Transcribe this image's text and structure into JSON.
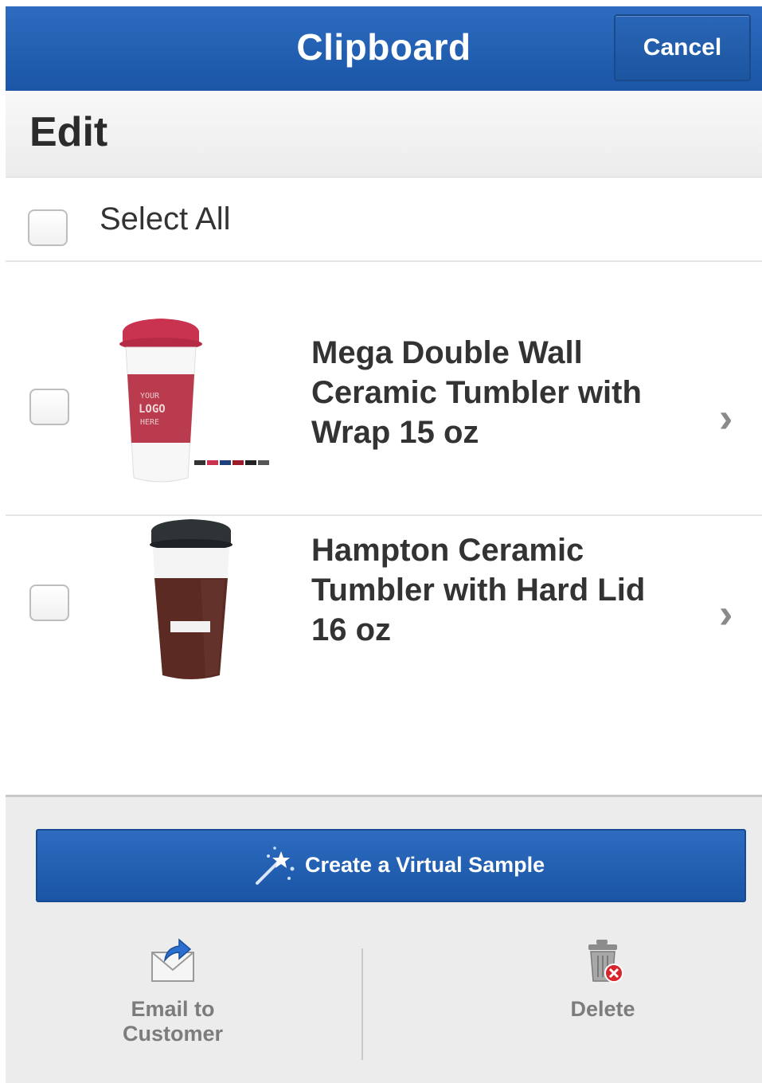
{
  "header": {
    "title": "Clipboard",
    "cancel_label": "Cancel"
  },
  "edit": {
    "title": "Edit"
  },
  "select_all": {
    "label": "Select All",
    "checked": false
  },
  "items": [
    {
      "title": "Mega Double Wall Ceramic Tumbler with Wrap 15 oz",
      "checked": false,
      "thumb_icon": "red-ceramic-tumbler-image",
      "thumb_text": "YOUR LOGO HERE"
    },
    {
      "title": "Hampton Ceramic Tumbler with Hard Lid 16 oz",
      "checked": false,
      "thumb_icon": "brown-ceramic-tumbler-image"
    }
  ],
  "actions": {
    "virtual_sample_label": "Create a Virtual Sample",
    "email_label_line1": "Email to",
    "email_label_line2": "Customer",
    "delete_label": "Delete"
  },
  "colors": {
    "header_blue": "#1f5fb3",
    "button_blue": "#2366ba",
    "delete_badge_red": "#d8252b"
  }
}
